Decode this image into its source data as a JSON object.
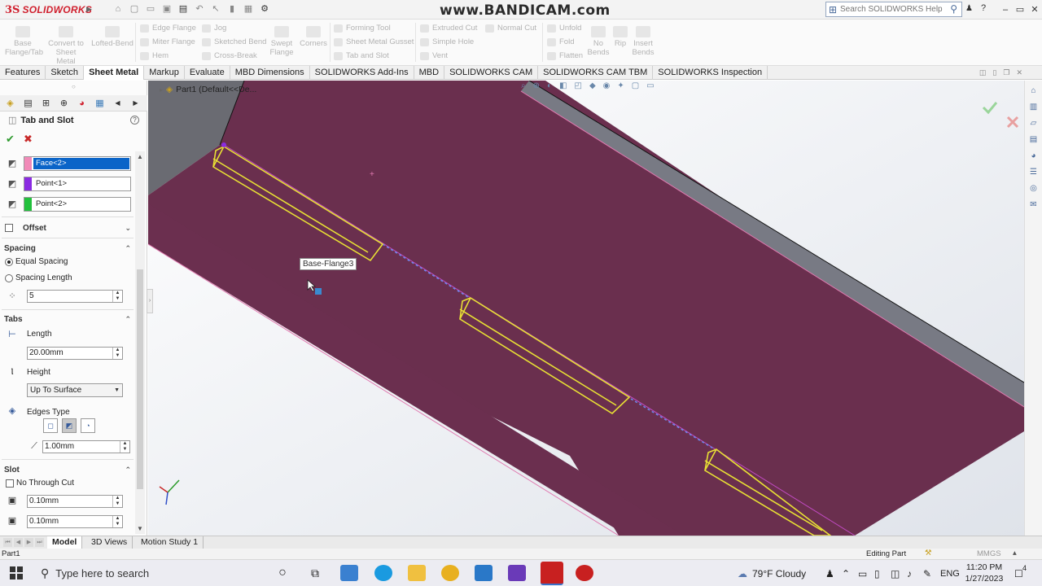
{
  "app": {
    "brand": "SOLIDWORKS",
    "watermark": "www.BANDICAM.com",
    "search_placeholder": "Search SOLIDWORKS Help"
  },
  "ribbon": {
    "base_flange": "Base Flange/Tab",
    "convert": "Convert to Sheet Metal",
    "lofted_bend": "Lofted-Bend",
    "edge_flange": "Edge Flange",
    "miter_flange": "Miter Flange",
    "hem": "Hem",
    "jog": "Jog",
    "sketched_bend": "Sketched Bend",
    "cross_break": "Cross-Break",
    "swept_flange": "Swept Flange",
    "corners": "Corners",
    "forming_tool": "Forming Tool",
    "gusset": "Sheet Metal Gusset",
    "tab_slot": "Tab and Slot",
    "extruded_cut": "Extruded Cut",
    "simple_hole": "Simple Hole",
    "vent": "Vent",
    "normal_cut": "Normal Cut",
    "unfold": "Unfold",
    "fold": "Fold",
    "flatten": "Flatten",
    "no_bends": "No Bends",
    "rip": "Rip",
    "insert_bends": "Insert Bends"
  },
  "tabs": [
    "Features",
    "Sketch",
    "Sheet Metal",
    "Markup",
    "Evaluate",
    "MBD Dimensions",
    "SOLIDWORKS Add-Ins",
    "MBD",
    "SOLIDWORKS CAM",
    "SOLIDWORKS CAM TBM",
    "SOLIDWORKS Inspection"
  ],
  "active_tab": "Sheet Metal",
  "property_manager": {
    "title": "Tab and Slot",
    "selections": [
      {
        "value": "Face<2>",
        "color": "#f18ab8"
      },
      {
        "value": "Point<1>",
        "color": "#8a2be2"
      },
      {
        "value": "Point<2>",
        "color": "#22c03c"
      }
    ],
    "offset_label": "Offset",
    "spacing": {
      "heading": "Spacing",
      "equal": "Equal Spacing",
      "length": "Spacing Length",
      "count": "5"
    },
    "tabs_section": {
      "heading": "Tabs",
      "length_label": "Length",
      "length_value": "20.00mm",
      "height_label": "Height",
      "height_option": "Up To Surface",
      "edges_label": "Edges Type",
      "edge_value": "1.00mm"
    },
    "slot": {
      "heading": "Slot",
      "no_through": "No Through Cut",
      "v1": "0.10mm",
      "v2": "0.10mm"
    }
  },
  "viewport": {
    "breadcrumb": "Part1  (Default<<De...",
    "tooltip": "Base-Flange3",
    "colors": {
      "face": "#6a2f4e",
      "tab_outline": "#e8e034"
    }
  },
  "bottom_tabs": [
    "Model",
    "3D Views",
    "Motion Study 1"
  ],
  "status": {
    "left": "Part1",
    "mode": "Editing Part",
    "units": "MMGS"
  },
  "taskbar": {
    "search": "Type here to search",
    "weather": "79°F  Cloudy",
    "lang": "ENG",
    "time": "11:20 PM",
    "date": "1/27/2023",
    "notif": "4"
  }
}
